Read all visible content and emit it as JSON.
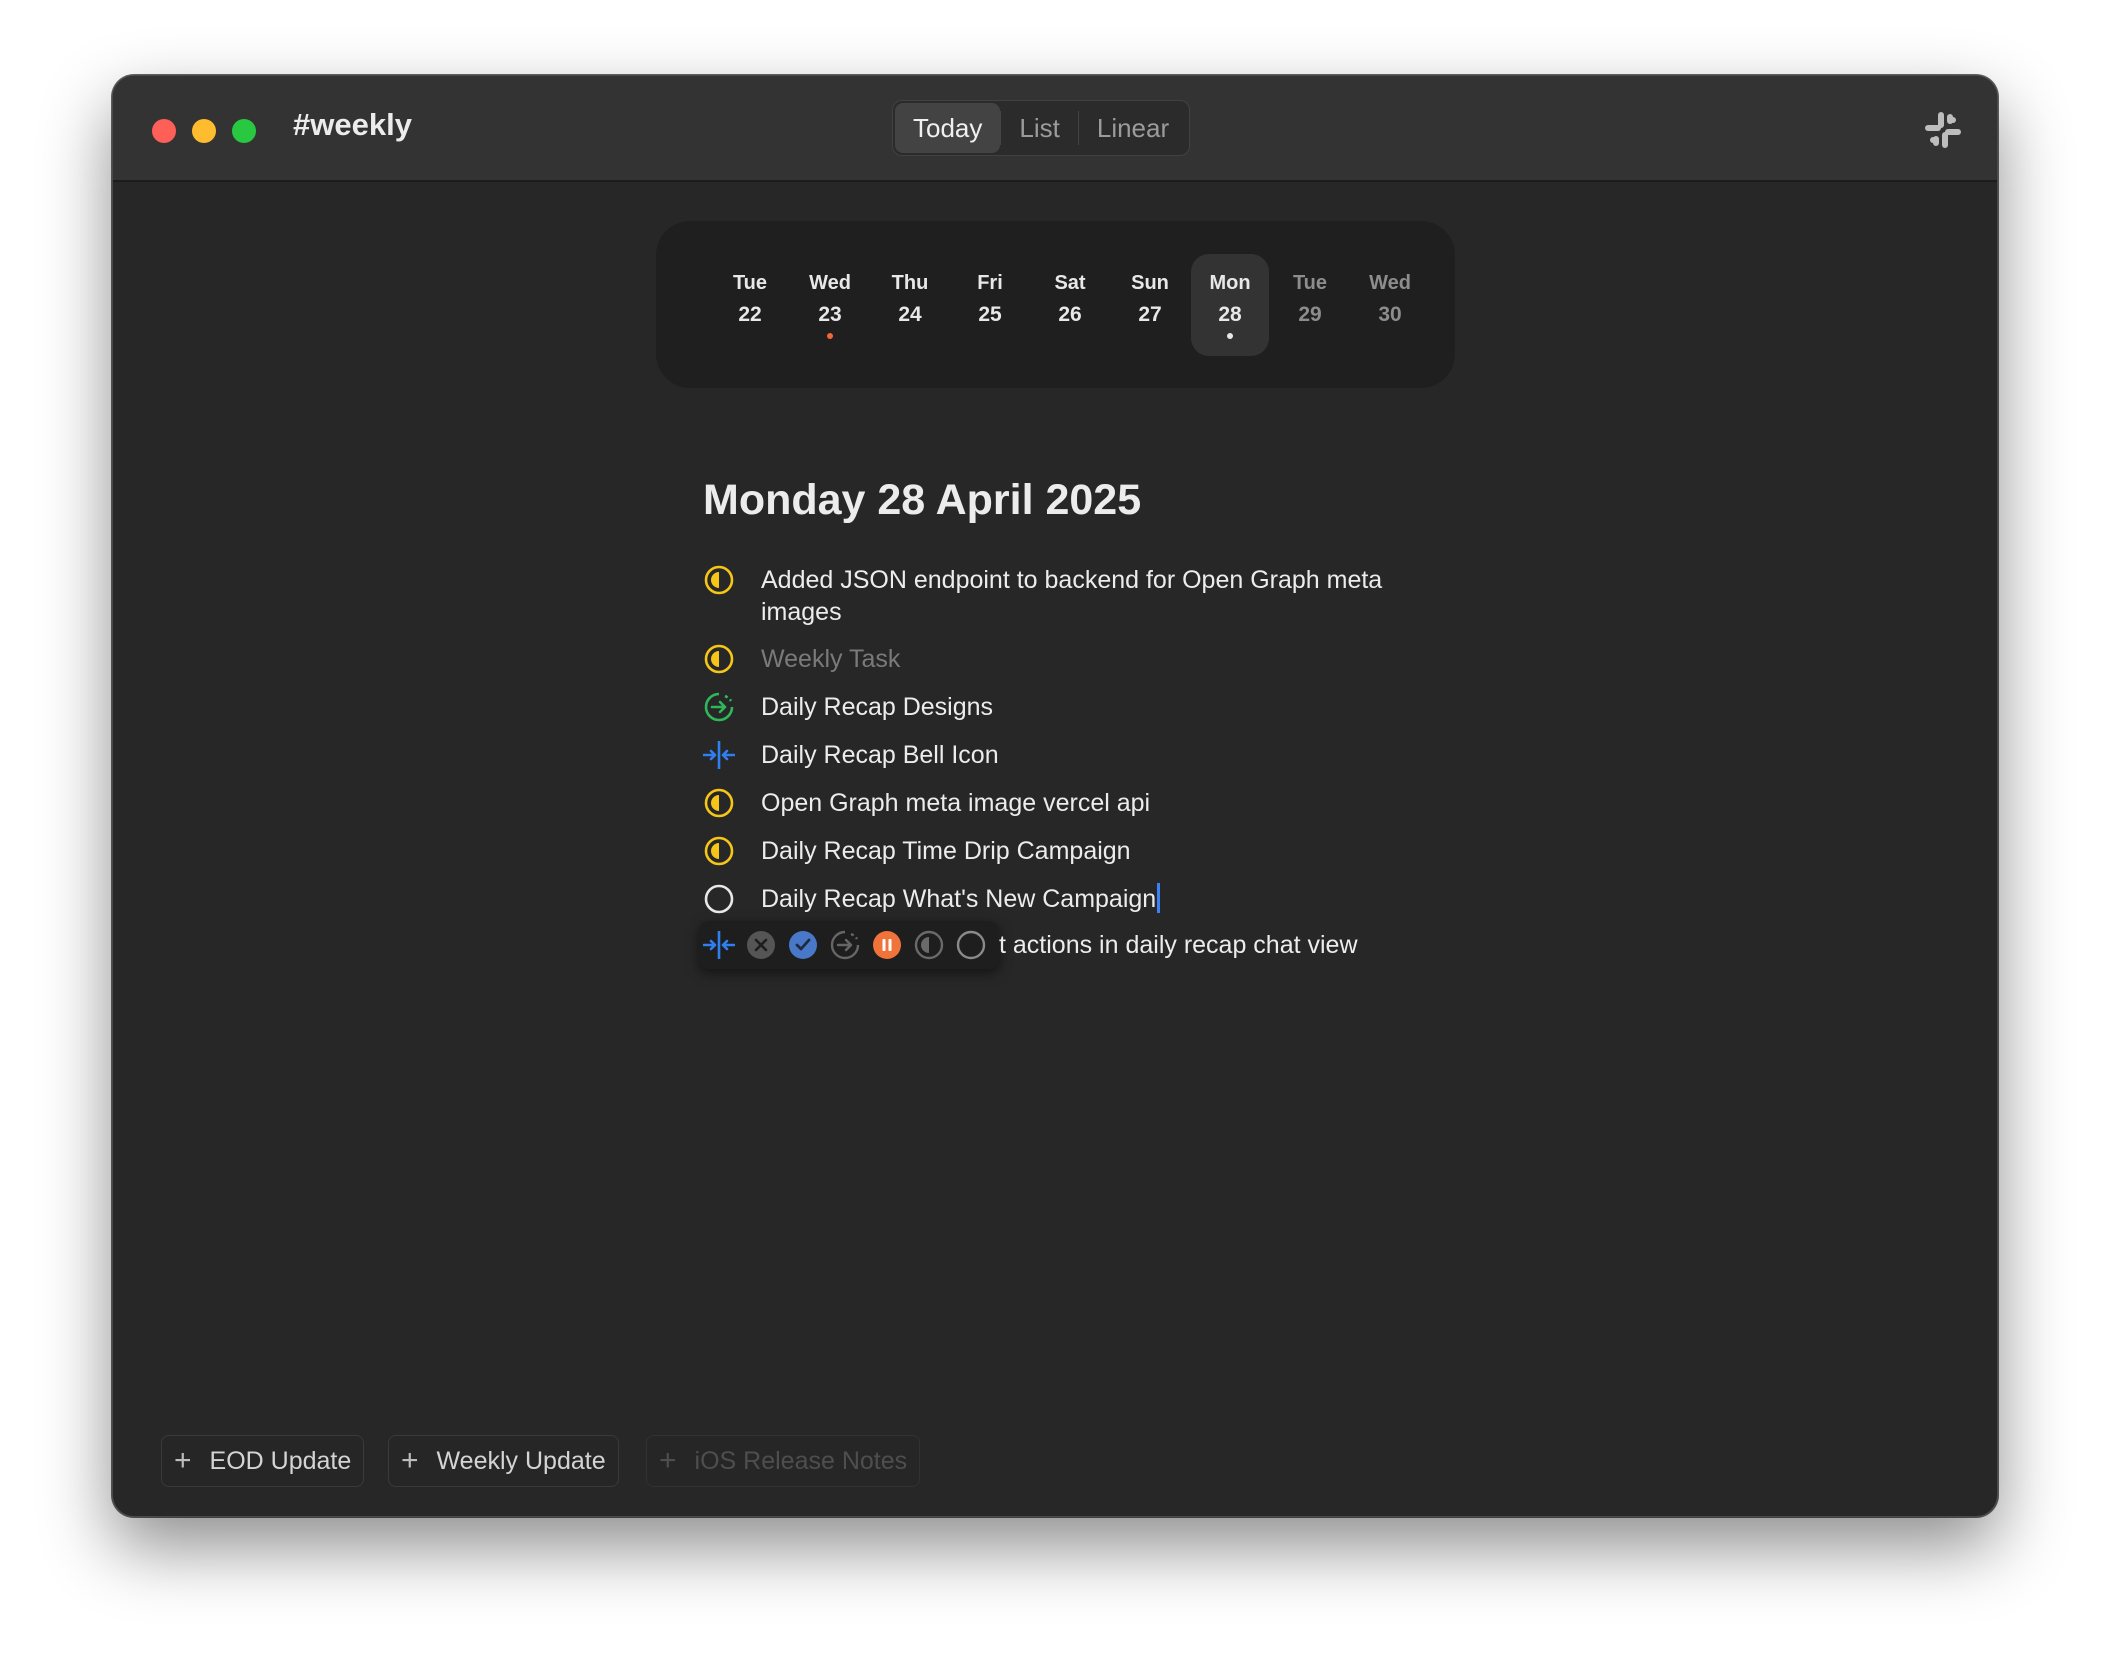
{
  "window": {
    "title": "#weekly",
    "view_tabs": [
      {
        "label": "Today",
        "active": true
      },
      {
        "label": "List",
        "active": false
      },
      {
        "label": "Linear",
        "active": false
      }
    ],
    "integration_icon": "slack-icon"
  },
  "calendar": {
    "days": [
      {
        "name": "Tue",
        "num": "22",
        "marker": "none",
        "state": "past"
      },
      {
        "name": "Wed",
        "num": "23",
        "marker": "orange",
        "state": "past"
      },
      {
        "name": "Thu",
        "num": "24",
        "marker": "none",
        "state": "past"
      },
      {
        "name": "Fri",
        "num": "25",
        "marker": "none",
        "state": "past"
      },
      {
        "name": "Sat",
        "num": "26",
        "marker": "none",
        "state": "past"
      },
      {
        "name": "Sun",
        "num": "27",
        "marker": "none",
        "state": "past"
      },
      {
        "name": "Mon",
        "num": "28",
        "marker": "white",
        "state": "selected"
      },
      {
        "name": "Tue",
        "num": "29",
        "marker": "none",
        "state": "future"
      },
      {
        "name": "Wed",
        "num": "30",
        "marker": "none",
        "state": "future"
      }
    ]
  },
  "main": {
    "date_heading": "Monday 28 April 2025",
    "tasks": [
      {
        "status": "in-progress",
        "icon": "half-circle-icon",
        "text": "Added JSON endpoint to backend for Open Graph meta images"
      },
      {
        "status": "in-progress",
        "icon": "half-circle-icon",
        "text": "Weekly Task",
        "dim": true
      },
      {
        "status": "moved",
        "icon": "arrow-circle-icon",
        "text": "Daily Recap Designs"
      },
      {
        "status": "merged",
        "icon": "merge-arrows-icon",
        "text": "Daily Recap Bell Icon"
      },
      {
        "status": "in-progress",
        "icon": "half-circle-icon",
        "text": "Open Graph meta image vercel api"
      },
      {
        "status": "in-progress",
        "icon": "half-circle-icon",
        "text": "Daily Recap Time Drip Campaign"
      },
      {
        "status": "todo",
        "icon": "empty-circle-icon",
        "text": "Daily Recap What's New Campaign"
      }
    ],
    "editing_task_visible_text": "t actions in daily recap chat view",
    "status_picker": [
      "merge-arrows-icon",
      "cancel-icon",
      "done-icon",
      "moved-icon",
      "paused-icon",
      "in-progress-icon",
      "todo-icon"
    ]
  },
  "footer": {
    "buttons": [
      {
        "label": "EOD Update",
        "enabled": true
      },
      {
        "label": "Weekly Update",
        "enabled": true
      },
      {
        "label": "iOS Release Notes",
        "enabled": false
      }
    ]
  },
  "colors": {
    "in_progress": "#f5c518",
    "moved": "#2fb75a",
    "merged": "#2f7ff0",
    "paused": "#f0743a",
    "done": "#4a78c8"
  }
}
